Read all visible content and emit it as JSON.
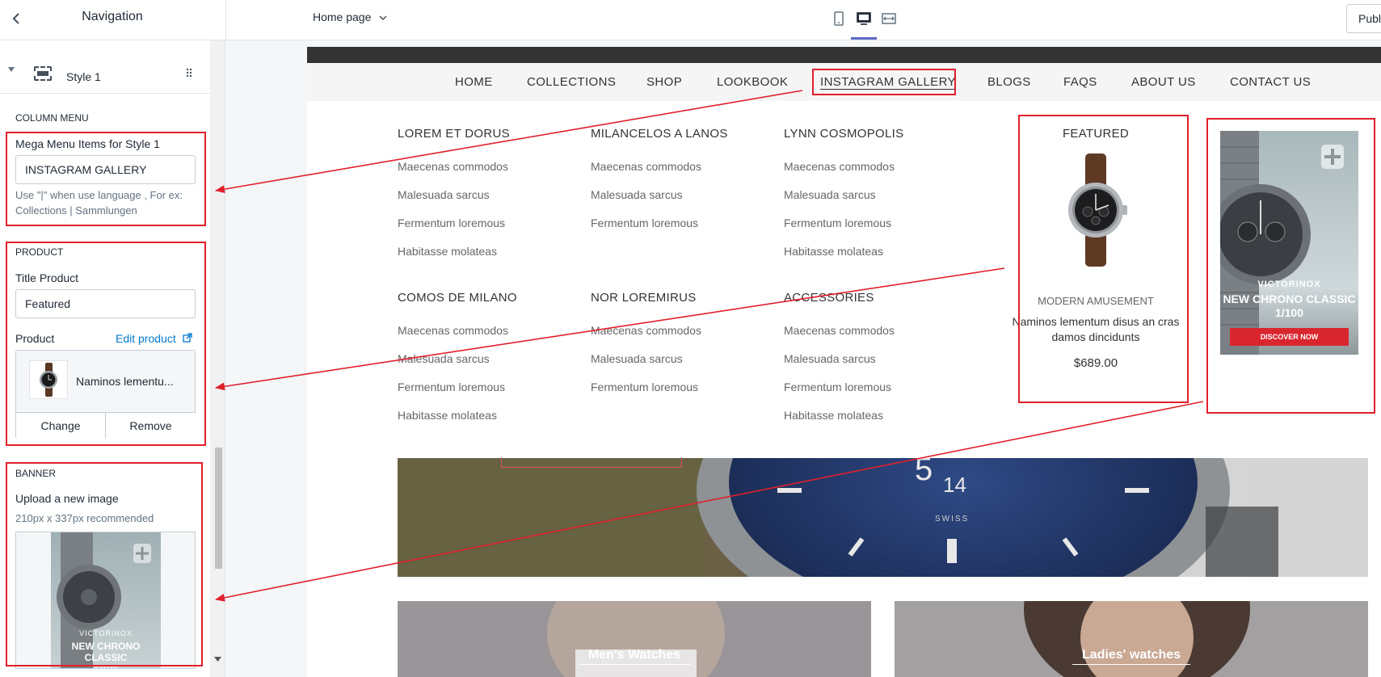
{
  "topbar": {
    "title": "Navigation",
    "page_selector": "Home page",
    "publish_label": "Publ"
  },
  "sidebar": {
    "style_label": "Style 1",
    "column_menu": {
      "heading": "COLUMN MENU",
      "field_label": "Mega Menu Items for Style 1",
      "field_value": "INSTAGRAM GALLERY",
      "help_line1": "Use \"|\" when use language , For ex:",
      "help_line2": "Collections | Sammlungen"
    },
    "product": {
      "heading": "PRODUCT",
      "title_label": "Title Product",
      "title_value": "Featured",
      "product_label": "Product",
      "edit_link": "Edit product",
      "product_name": "Naminos lementu...",
      "change_button": "Change",
      "remove_button": "Remove"
    },
    "banner": {
      "heading": "BANNER",
      "upload_label": "Upload a new image",
      "recommend": "210px x 337px recommended"
    }
  },
  "preview": {
    "nav": [
      "HOME",
      "COLLECTIONS",
      "SHOP",
      "LOOKBOOK",
      "INSTAGRAM GALLERY",
      "BLOGS",
      "FAQS",
      "ABOUT US",
      "CONTACT US"
    ],
    "columns": [
      {
        "title": "LOREM ET DORUS",
        "links": [
          "Maecenas commodos",
          "Malesuada sarcus",
          "Fermentum loremous",
          "Habitasse molateas"
        ]
      },
      {
        "title": "MILANCELOS A LANOS",
        "links": [
          "Maecenas commodos",
          "Malesuada sarcus",
          "Fermentum loremous"
        ]
      },
      {
        "title": "LYNN COSMOPOLIS",
        "links": [
          "Maecenas commodos",
          "Malesuada sarcus",
          "Fermentum loremous",
          "Habitasse molateas"
        ]
      },
      {
        "title": "COMOS DE MILANO",
        "links": [
          "Maecenas commodos",
          "Malesuada sarcus",
          "Fermentum loremous",
          "Habitasse molateas"
        ]
      },
      {
        "title": "NOR LOREMIRUS",
        "links": [
          "Maecenas commodos",
          "Malesuada sarcus",
          "Fermentum loremous"
        ]
      },
      {
        "title": "ACCESSORIES",
        "links": [
          "Maecenas commodos",
          "Malesuada sarcus",
          "Fermentum loremous",
          "Habitasse molateas"
        ]
      }
    ],
    "featured": {
      "title": "FEATURED",
      "vendor": "MODERN AMUSEMENT",
      "product_name": "Naminos lementum disus an cras damos dincidunts",
      "price": "$689.00"
    },
    "banner": {
      "brand": "VICTORINOX",
      "headline_line1": "NEW CHRONO CLASSIC",
      "headline_line2": "1/100",
      "cta": "DISCOVER NOW"
    },
    "hero": {
      "dial_numbers": [
        "5",
        "14"
      ],
      "dial_text": "SWISS"
    },
    "cards": [
      "Men's Watches",
      "Ladies' watches"
    ]
  },
  "colors": {
    "annotation_red": "#e0202a",
    "link_blue": "#007ace",
    "accent": "#5c6ac4"
  },
  "icons": {
    "back": "chevron-left-icon",
    "mobile": "mobile-icon",
    "desktop": "desktop-icon",
    "fullwidth": "fullwidth-icon",
    "drag": "drag-handle-icon",
    "external": "external-link-icon"
  }
}
